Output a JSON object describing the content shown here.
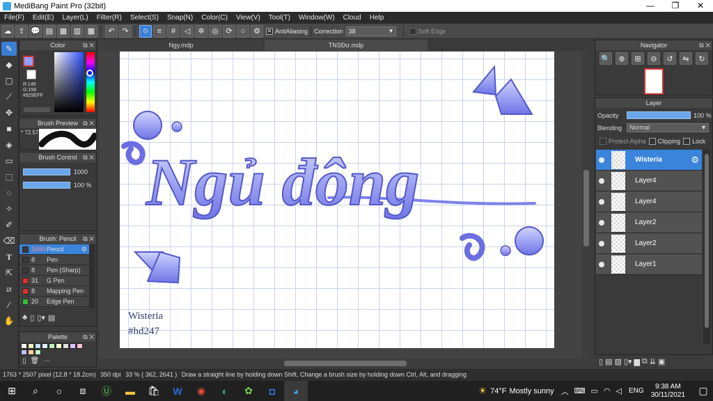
{
  "window": {
    "title": "MediBang Paint Pro (32bit)",
    "minimize": "—",
    "maximize": "❐",
    "close": "✕"
  },
  "menu": [
    "File(F)",
    "Edit(E)",
    "Layer(L)",
    "Filter(R)",
    "Select(S)",
    "Snap(N)",
    "Color(C)",
    "View(V)",
    "Tool(T)",
    "Window(W)",
    "Cloud",
    "Help"
  ],
  "toolbar": {
    "antialiasing_label": "AntiAliasing",
    "correction_label": "Correction",
    "correction_value": "38",
    "soft_edge_label": "Soft Edge"
  },
  "color_panel": {
    "title": "Color",
    "r": "R:146",
    "g": "G:158",
    "hex": "#929EFF",
    "fg_color": "#929EFF"
  },
  "brush_preview": {
    "title": "Brush Preview",
    "size": "* 72.57"
  },
  "brush_control": {
    "title": "Brush Control",
    "size_value": "1000",
    "opacity_value": "100 %"
  },
  "brush_list": {
    "title": "Brush: Pencil",
    "items": [
      {
        "size": "1000",
        "name": "Pencil",
        "color": "#3a3a3a"
      },
      {
        "size": "8",
        "name": "Pen",
        "color": "#3a3a3a"
      },
      {
        "size": "8",
        "name": "Pen (Sharp)",
        "color": "#3a3a3a"
      },
      {
        "size": "31",
        "name": "G Pen",
        "color": "#e03030"
      },
      {
        "size": "8",
        "name": "Mapping Pen",
        "color": "#e03030"
      },
      {
        "size": "20",
        "name": "Edge Pen",
        "color": "#30c030"
      }
    ]
  },
  "palette": {
    "title": "Palette",
    "more": "···",
    "swatches": [
      "#ffffff",
      "#f0f0c0",
      "#c8e0ff",
      "#d8f0ff",
      "#c0f0c0",
      "#ffffd0",
      "#e0e0e0",
      "#e0c0ff",
      "#ffc0d0",
      "#c0c0ff",
      "#ffd0a0",
      "#c0ffc0"
    ]
  },
  "tabs": [
    "Ngy.mdp",
    "TNSĐư.mdp"
  ],
  "artwork": {
    "title_text": "Ngủ đông",
    "signature_line1": "Wisteria",
    "signature_line2": "#hd247"
  },
  "navigator": {
    "title": "Navigator"
  },
  "layer_panel": {
    "title": "Layer",
    "opacity_label": "Opacity",
    "opacity_value": "100 %",
    "opacity_fraction": 1.0,
    "blending_label": "Blending",
    "blending_value": "Normal",
    "protect_alpha": "Protect Alpha",
    "clipping": "Clipping",
    "lock": "Lock",
    "layers": [
      {
        "name": "Wisteria",
        "selected": true
      },
      {
        "name": "Layer4",
        "selected": false
      },
      {
        "name": "Layer4",
        "selected": false
      },
      {
        "name": "Layer2",
        "selected": false
      },
      {
        "name": "Layer2",
        "selected": false
      },
      {
        "name": "Layer1",
        "selected": false
      }
    ]
  },
  "status": {
    "size": "1763 * 2507 pixel",
    "cm": "(12.8 * 18.2cm)",
    "dpi": "350 dpi",
    "zoom": "33 %",
    "coords": "( 362, 2641 )",
    "hint": "Draw a straight line by holding down Shift, Change a brush size by holding down Ctrl, Alt, and dragging"
  },
  "taskbar": {
    "weather_temp": "74°F",
    "weather_text": "Mostly sunny",
    "language": "ENG",
    "time": "9:38 AM",
    "date": "30/11/2021"
  }
}
